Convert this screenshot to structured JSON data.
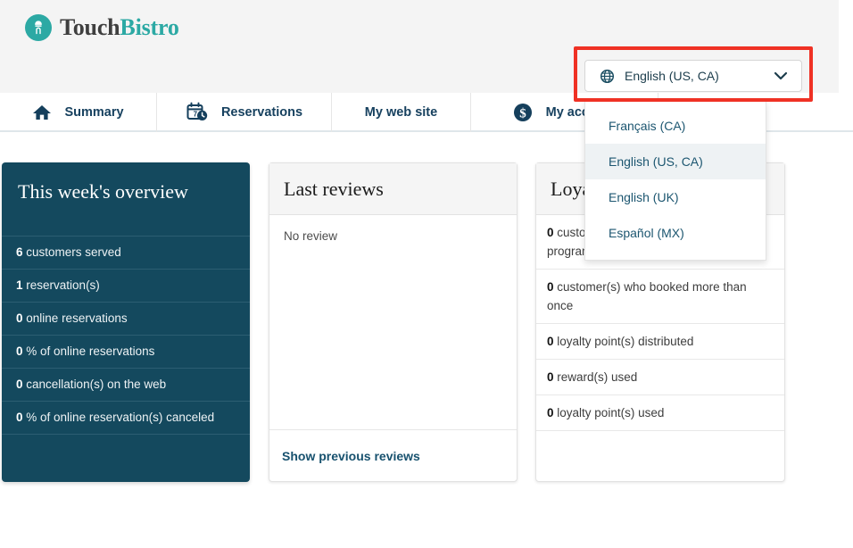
{
  "brand": {
    "name_part1": "Touch",
    "name_part2": "Bistro",
    "logo_icon": "chef-hat-fingerprint-icon",
    "accent_color": "#2ca9a4",
    "dark_color": "#3f3f3f"
  },
  "language_selector": {
    "icon": "globe-icon",
    "selected": "English (US, CA)",
    "chevron": "chevron-down-icon",
    "highlight_color": "#ef3124",
    "options": [
      {
        "label": "Français (CA)",
        "selected": false
      },
      {
        "label": "English (US, CA)",
        "selected": true
      },
      {
        "label": "English (UK)",
        "selected": false
      },
      {
        "label": "Español (MX)",
        "selected": false
      }
    ]
  },
  "nav": {
    "items": [
      {
        "label": "Summary",
        "icon": "home-icon"
      },
      {
        "label": "Reservations",
        "icon": "calendar-clock-icon"
      },
      {
        "label": "My web site",
        "icon": ""
      },
      {
        "label": "My account",
        "icon": "dollar-circle-icon"
      }
    ]
  },
  "overview": {
    "title": "This week's overview",
    "rows": [
      {
        "value": "6",
        "label": "customers served"
      },
      {
        "value": "1",
        "label": "reservation(s)"
      },
      {
        "value": "0",
        "label": "online reservations"
      },
      {
        "value": "0",
        "label": "% of online reservations"
      },
      {
        "value": "0",
        "label": "cancellation(s) on the web"
      },
      {
        "value": "0",
        "label": "% of online reservation(s) canceled"
      }
    ]
  },
  "reviews": {
    "title": "Last reviews",
    "empty_text": "No review",
    "footer_link": "Show previous reviews"
  },
  "loyalty": {
    "title": "Loyalty",
    "rows": [
      {
        "value": "0",
        "label": "customer(s) enrolled in the loyalty program"
      },
      {
        "value": "0",
        "label": "customer(s) who booked more than once"
      },
      {
        "value": "0",
        "label": "loyalty point(s) distributed"
      },
      {
        "value": "0",
        "label": "reward(s) used"
      },
      {
        "value": "0",
        "label": "loyalty point(s) used"
      }
    ]
  }
}
